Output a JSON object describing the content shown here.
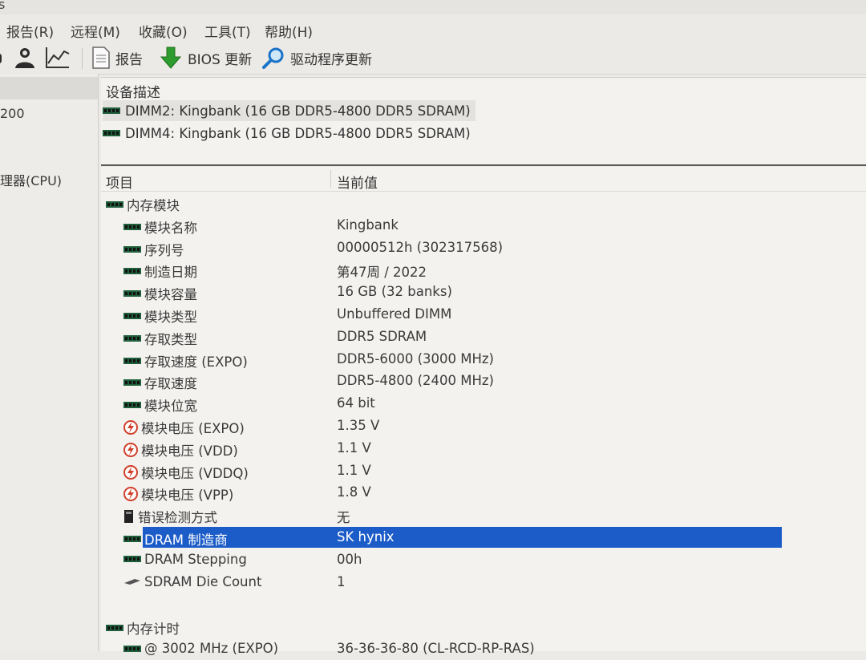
{
  "title_fragment": "s",
  "menu": [
    {
      "label": "报告(R)"
    },
    {
      "label": "远程(M)"
    },
    {
      "label": "收藏(O)"
    },
    {
      "label": "工具(T)"
    },
    {
      "label": "帮助(H)"
    }
  ],
  "toolbar": {
    "report_label": "报告",
    "bios_label": "BIOS 更新",
    "driver_label": "驱动程序更新"
  },
  "left_panel": {
    "items": [
      {
        "label": "200"
      },
      {
        "label": "理器(CPU)"
      }
    ]
  },
  "device_pane": {
    "header": "设备描述",
    "devices": [
      {
        "label": "DIMM2: Kingbank (16 GB DDR5-4800 DDR5 SDRAM)"
      },
      {
        "label": "DIMM4: Kingbank (16 GB DDR5-4800 DDR5 SDRAM)"
      }
    ]
  },
  "properties": {
    "col_item": "项目",
    "col_value": "当前值",
    "group_module": "内存模块",
    "rows": [
      {
        "name": "模块名称",
        "value": "Kingbank",
        "icon": "ram-icon"
      },
      {
        "name": "序列号",
        "value": "00000512h (302317568)",
        "icon": "ram-icon"
      },
      {
        "name": "制造日期",
        "value": "第47周 / 2022",
        "icon": "ram-icon"
      },
      {
        "name": "模块容量",
        "value": "16 GB (32 banks)",
        "icon": "ram-icon"
      },
      {
        "name": "模块类型",
        "value": "Unbuffered DIMM",
        "icon": "ram-icon"
      },
      {
        "name": "存取类型",
        "value": "DDR5 SDRAM",
        "icon": "ram-icon"
      },
      {
        "name": "存取速度 (EXPO)",
        "value": "DDR5-6000 (3000 MHz)",
        "icon": "ram-icon"
      },
      {
        "name": "存取速度",
        "value": "DDR5-4800 (2400 MHz)",
        "icon": "ram-icon"
      },
      {
        "name": "模块位宽",
        "value": "64 bit",
        "icon": "ram-icon"
      },
      {
        "name": "模块电压 (EXPO)",
        "value": "1.35 V",
        "icon": "voltage-icon"
      },
      {
        "name": "模块电压 (VDD)",
        "value": "1.1 V",
        "icon": "voltage-icon"
      },
      {
        "name": "模块电压 (VDDQ)",
        "value": "1.1 V",
        "icon": "voltage-icon"
      },
      {
        "name": "模块电压 (VPP)",
        "value": "1.8 V",
        "icon": "voltage-icon"
      },
      {
        "name": "错误检测方式",
        "value": "无",
        "icon": "book-icon"
      },
      {
        "name": "DRAM 制造商",
        "value": "SK hynix",
        "icon": "ram-icon"
      },
      {
        "name": "DRAM Stepping",
        "value": "00h",
        "icon": "ram-icon"
      },
      {
        "name": "SDRAM Die Count",
        "value": "1",
        "icon": "die-icon"
      }
    ],
    "group_timing": "内存计时",
    "timing_rows": [
      {
        "name": "@ 3002 MHz (EXPO)",
        "value": "36-36-36-80  (CL-RCD-RP-RAS)",
        "icon": "ram-icon"
      }
    ]
  },
  "colors": {
    "selection": "#1c5cc8",
    "ram_icon_green": "#1f5e3a",
    "voltage_icon": "#d0402a"
  }
}
